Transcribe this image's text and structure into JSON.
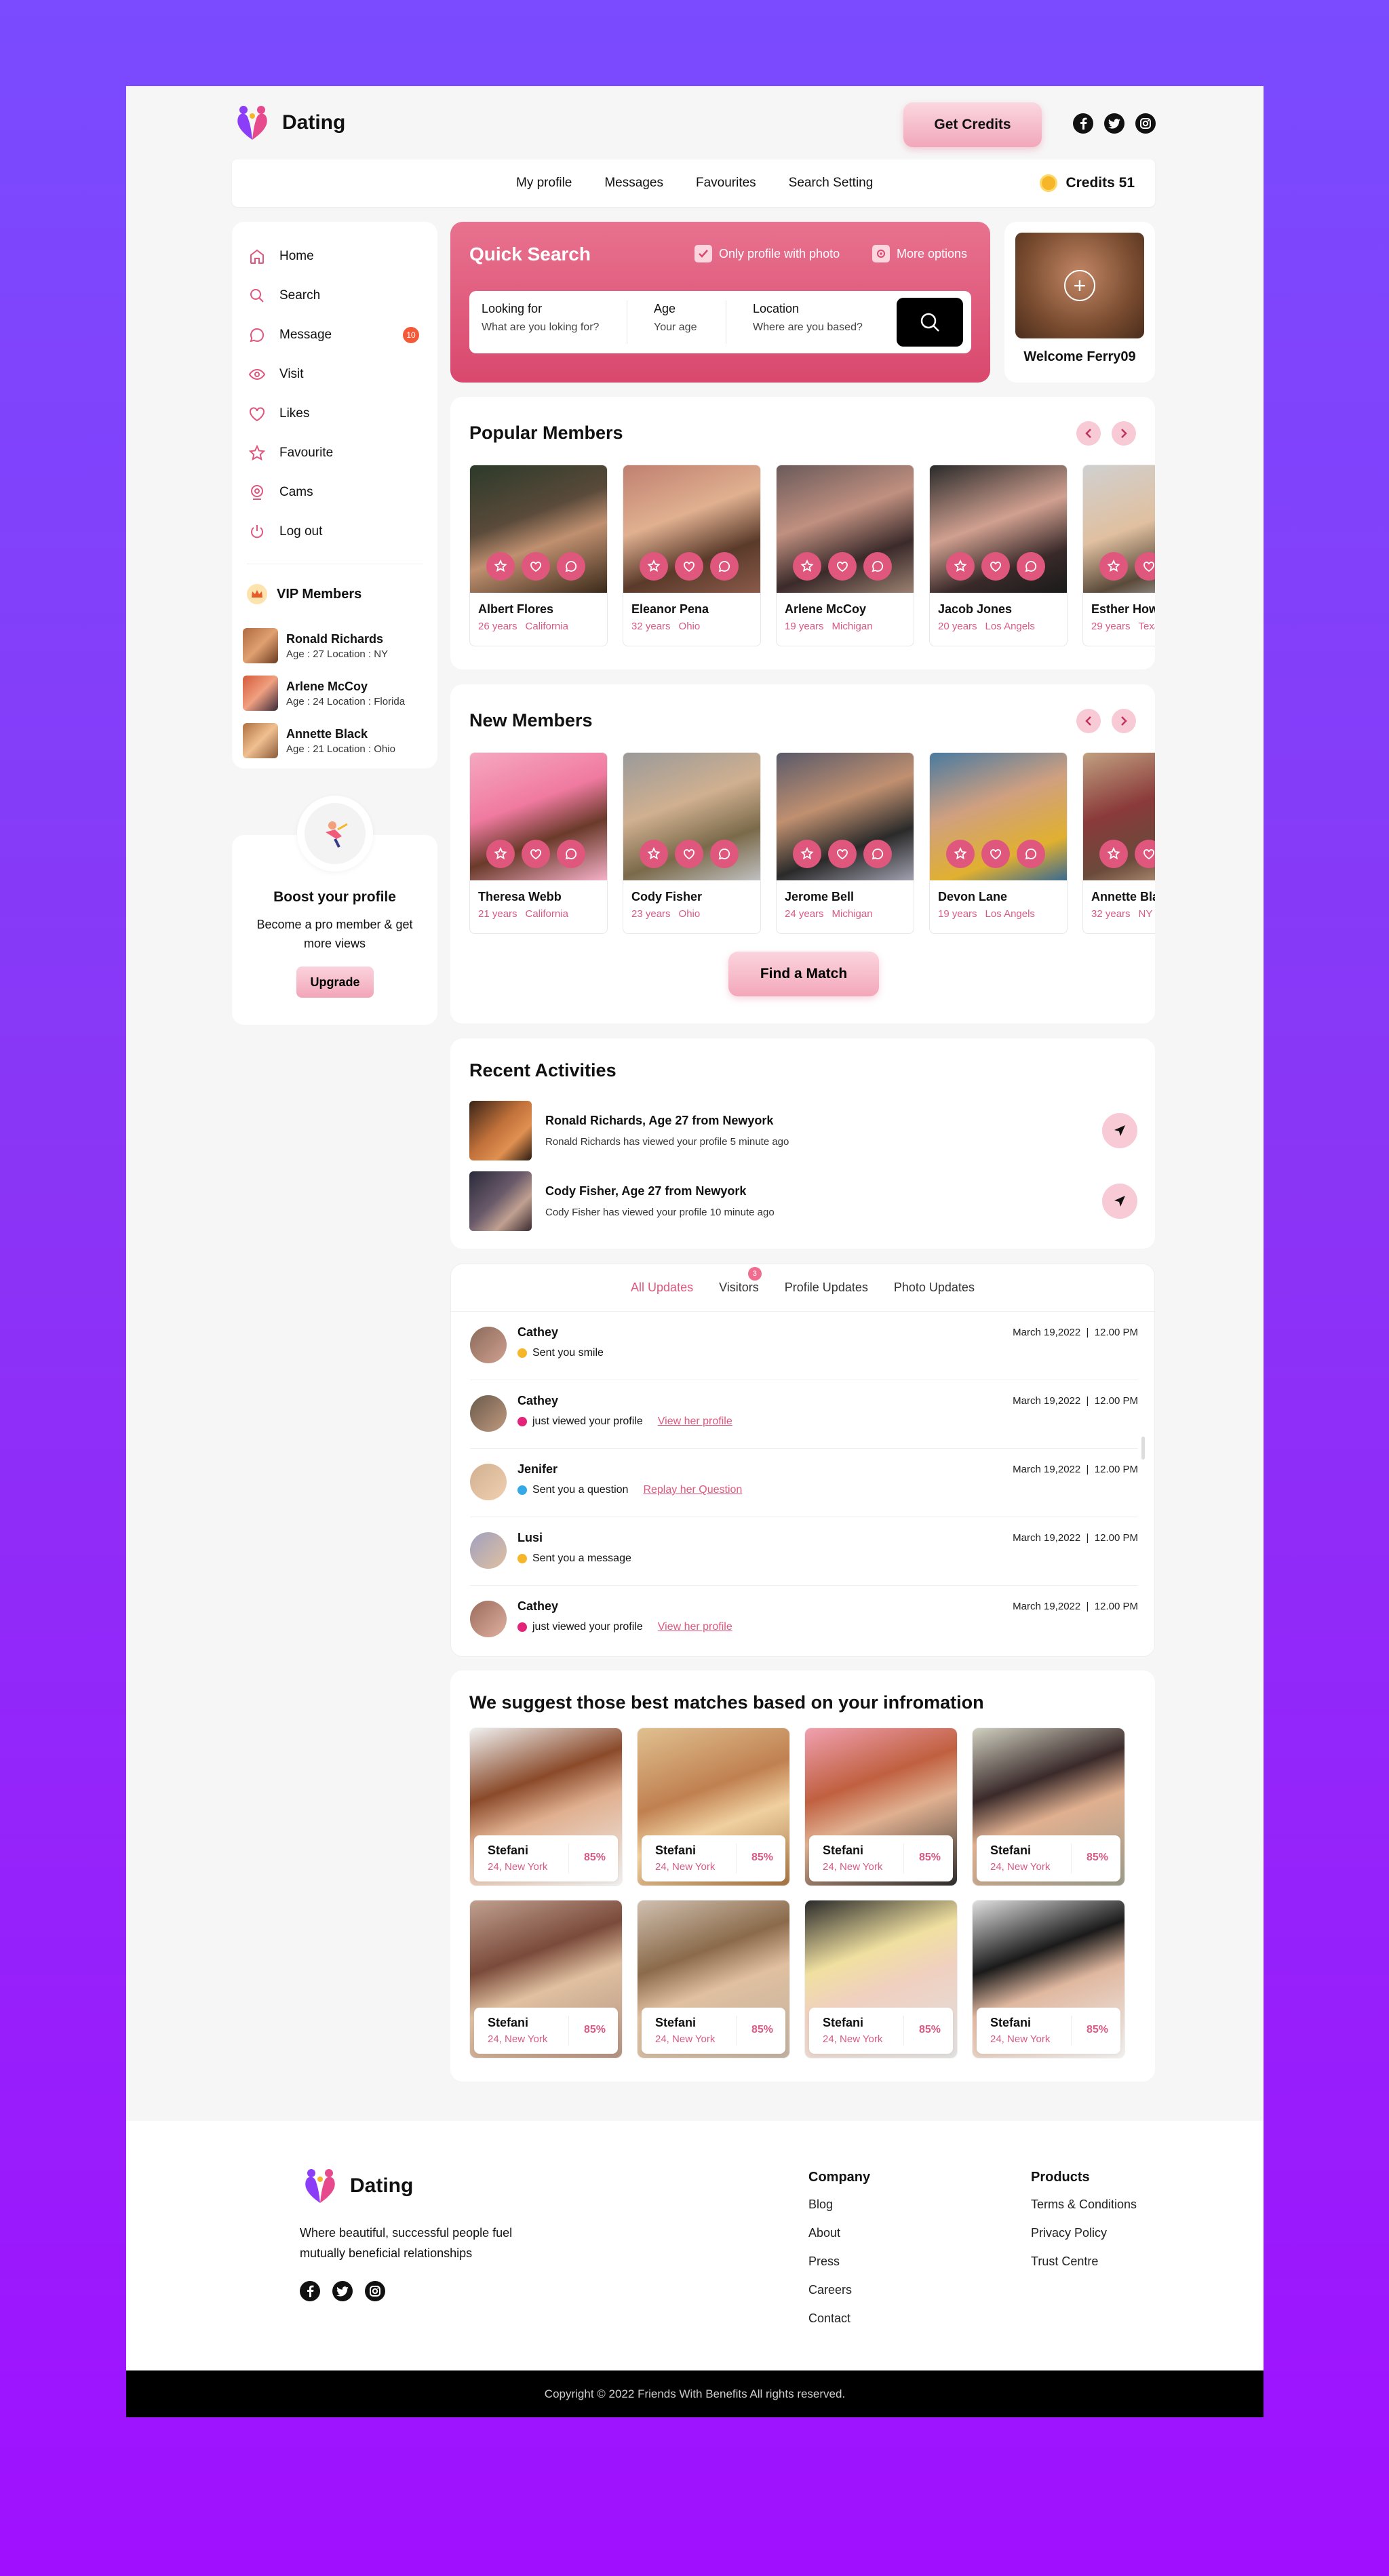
{
  "brand": {
    "name": "Dating"
  },
  "header": {
    "credits_button": "Get Credits",
    "social": [
      "facebook-icon",
      "twitter-icon",
      "instagram-icon"
    ]
  },
  "nav": {
    "links": [
      "My profile",
      "Messages",
      "Favourites",
      "Search Setting"
    ],
    "credits": "Credits 51"
  },
  "sidebar": {
    "items": [
      {
        "label": "Home",
        "icon": "home-icon"
      },
      {
        "label": "Search",
        "icon": "search-icon"
      },
      {
        "label": "Message",
        "icon": "message-icon",
        "badge": "10"
      },
      {
        "label": "Visit",
        "icon": "eye-icon"
      },
      {
        "label": "Likes",
        "icon": "heart-icon"
      },
      {
        "label": "Favourite",
        "icon": "star-icon"
      },
      {
        "label": "Cams",
        "icon": "webcam-icon"
      },
      {
        "label": "Log out",
        "icon": "power-icon"
      }
    ],
    "vip_title": "VIP Members",
    "vip": [
      {
        "name": "Ronald Richards",
        "info": "Age : 27   Location : NY"
      },
      {
        "name": "Arlene McCoy",
        "info": "Age : 24   Location : Florida"
      },
      {
        "name": "Annette Black",
        "info": "Age : 21   Location : Ohio"
      }
    ]
  },
  "boost": {
    "title": "Boost your profile",
    "text": "Become a pro member & get more views",
    "button": "Upgrade"
  },
  "quick_search": {
    "title": "Quick Search",
    "option_photo": "Only profile with photo",
    "option_more": "More options",
    "fields": [
      {
        "label": "Looking for",
        "placeholder": "What are you loking for?"
      },
      {
        "label": "Age",
        "placeholder": "Your age"
      },
      {
        "label": "Location",
        "placeholder": "Where are you based?"
      }
    ]
  },
  "welcome": {
    "text": "Welcome Ferry09"
  },
  "popular": {
    "title": "Popular Members",
    "members": [
      {
        "name": "Albert Flores",
        "age": "26 years",
        "location": "California"
      },
      {
        "name": "Eleanor Pena",
        "age": "32 years",
        "location": "Ohio"
      },
      {
        "name": "Arlene McCoy",
        "age": "19 years",
        "location": "Michigan"
      },
      {
        "name": "Jacob Jones",
        "age": "20 years",
        "location": "Los Angels"
      },
      {
        "name": "Esther Howard",
        "age": "29 years",
        "location": "Texas"
      }
    ]
  },
  "new_members": {
    "title": "New Members",
    "members": [
      {
        "name": "Theresa Webb",
        "age": "21 years",
        "location": "California"
      },
      {
        "name": "Cody Fisher",
        "age": "23 years",
        "location": "Ohio"
      },
      {
        "name": "Jerome Bell",
        "age": "24 years",
        "location": "Michigan"
      },
      {
        "name": "Devon Lane",
        "age": "19 years",
        "location": "Los Angels"
      },
      {
        "name": "Annette Black",
        "age": "32 years",
        "location": "NY"
      }
    ],
    "button": "Find a Match"
  },
  "recent": {
    "title": "Recent Activities",
    "items": [
      {
        "title": "Ronald Richards, Age 27 from Newyork",
        "sub": "Ronald Richards has viewed your profile 5 minute ago"
      },
      {
        "title": "Cody Fisher, Age 27 from Newyork",
        "sub": "Cody Fisher has viewed your profile 10 minute ago"
      }
    ]
  },
  "updates": {
    "tabs": [
      "All Updates",
      "Visitors",
      "Profile Updates",
      "Photo Updates"
    ],
    "visitors_badge": "3",
    "items": [
      {
        "name": "Cathey",
        "text": "Sent you smile",
        "link": "",
        "date": "March 19,2022  |  12.00 PM",
        "dot": "#f6b629"
      },
      {
        "name": "Cathey",
        "text": "just viewed your profile",
        "link": "View her profile",
        "date": "March 19,2022  |  12.00 PM",
        "dot": "#e3257a"
      },
      {
        "name": "Jenifer",
        "text": "Sent you a question",
        "link": "Replay her Question",
        "date": "March 19,2022  |  12.00 PM",
        "dot": "#35a8e8"
      },
      {
        "name": "Lusi",
        "text": "Sent you a message",
        "link": "",
        "date": "March 19,2022  |  12.00 PM",
        "dot": "#f6b629"
      },
      {
        "name": "Cathey",
        "text": "just viewed your profile",
        "link": "View her profile",
        "date": "March 19,2022  |  12.00 PM",
        "dot": "#e3257a"
      }
    ]
  },
  "suggestions": {
    "title": "We suggest those best matches based on your infromation",
    "items": [
      {
        "name": "Stefani",
        "loc": "24, New York",
        "pct": "85%"
      },
      {
        "name": "Stefani",
        "loc": "24, New York",
        "pct": "85%"
      },
      {
        "name": "Stefani",
        "loc": "24, New York",
        "pct": "85%"
      },
      {
        "name": "Stefani",
        "loc": "24, New York",
        "pct": "85%"
      },
      {
        "name": "Stefani",
        "loc": "24, New York",
        "pct": "85%"
      },
      {
        "name": "Stefani",
        "loc": "24, New York",
        "pct": "85%"
      },
      {
        "name": "Stefani",
        "loc": "24, New York",
        "pct": "85%"
      },
      {
        "name": "Stefani",
        "loc": "24, New York",
        "pct": "85%"
      }
    ]
  },
  "footer": {
    "tagline": "Where beautiful, successful people fuel mutually beneficial relationships",
    "company_title": "Company",
    "company": [
      "Blog",
      "About",
      "Press",
      "Careers",
      "Contact"
    ],
    "products_title": "Products",
    "products": [
      "Terms & Conditions",
      "Privacy Policy",
      "Trust Centre"
    ],
    "copyright": "Copyright © 2022 Friends With Benefits All rights reserved."
  },
  "colors": {
    "accent": "#e0577d",
    "primary_bg": "#8a35f6",
    "credits_coin": "#f6b629"
  }
}
